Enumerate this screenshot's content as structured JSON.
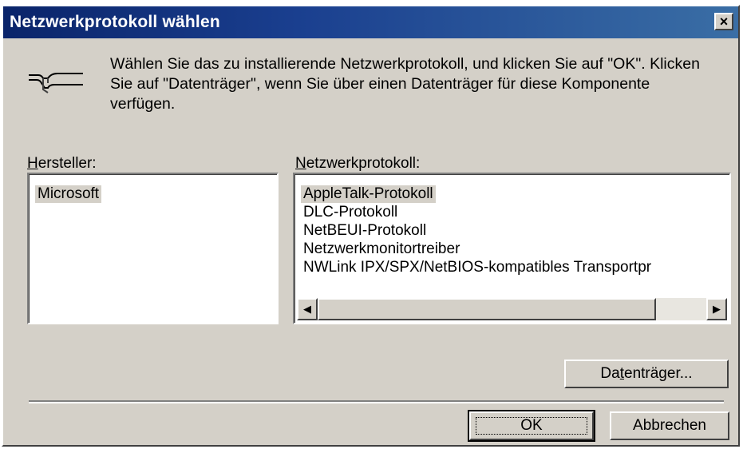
{
  "dialog": {
    "title": "Netzwerkprotokoll wählen",
    "close_label": "×",
    "description": "Wählen Sie das zu installierende Netzwerkprotokoll, und klicken Sie auf \"OK\". Klicken Sie auf \"Datenträger\", wenn Sie über einen Datenträger für diese Komponente verfügen."
  },
  "manufacturer": {
    "label_accel": "H",
    "label_rest": "ersteller:",
    "items": [
      "Microsoft"
    ],
    "selected": "Microsoft"
  },
  "protocol": {
    "label_accel": "N",
    "label_rest": "etzwerkprotokoll:",
    "items": [
      "AppleTalk-Protokoll",
      "DLC-Protokoll",
      "NetBEUI-Protokoll",
      "Netzwerkmonitortreiber",
      "NWLink IPX/SPX/NetBIOS-kompatibles Transportpr"
    ],
    "selected": "AppleTalk-Protokoll"
  },
  "buttons": {
    "disk_pre": "Da",
    "disk_accel": "t",
    "disk_post": "enträger...",
    "ok": "OK",
    "cancel": "Abbrechen"
  },
  "icons": {
    "network": "network-cable-icon",
    "scroll_left": "◀",
    "scroll_right": "▶"
  }
}
